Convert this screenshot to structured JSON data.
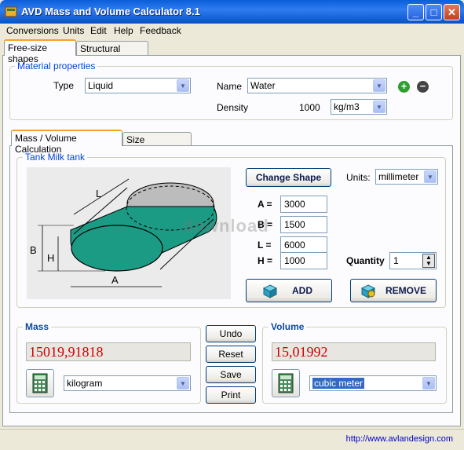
{
  "window": {
    "title": "AVD Mass and Volume Calculator 8.1",
    "minimize": "_",
    "maximize": "□",
    "close": "✕"
  },
  "menu": [
    "Conversions",
    "Units",
    "Edit",
    "Help",
    "Feedback"
  ],
  "top_tabs": [
    "Free-size shapes",
    "Structural shapes"
  ],
  "material": {
    "group_label": "Material properties",
    "type_label": "Type",
    "type_value": "Liquid",
    "name_label": "Name",
    "name_value": "Water",
    "density_label": "Density",
    "density_value": "1000",
    "density_unit": "kg/m3"
  },
  "calc_tabs": [
    "Mass / Volume  Calculation",
    "Size  Calculation"
  ],
  "shape": {
    "group_label": "Tank Milk tank",
    "change_shape": "Change Shape",
    "units_label": "Units:",
    "units_value": "millimeter",
    "diagram_labels": {
      "L": "L",
      "B": "B",
      "H": "H",
      "A": "A"
    },
    "watermark": "download",
    "dims": [
      {
        "label": "A  =",
        "value": "3000"
      },
      {
        "label": "B  =",
        "value": "1500"
      },
      {
        "label": "L  =",
        "value": "6000"
      },
      {
        "label": "H  =",
        "value": "1000"
      }
    ],
    "quantity_label": "Quantity",
    "quantity_value": "1",
    "add": "ADD",
    "remove": "REMOVE",
    "fill_color": "#1b9b84"
  },
  "mass": {
    "label": "Mass",
    "value": "15019,91818",
    "unit": "kilogram"
  },
  "volume": {
    "label": "Volume",
    "value": "15,01992",
    "unit": "cubic meter"
  },
  "actions": [
    "Undo",
    "Reset",
    "Save",
    "Print"
  ],
  "status": {
    "url": "http://www.avlandesign.com"
  }
}
